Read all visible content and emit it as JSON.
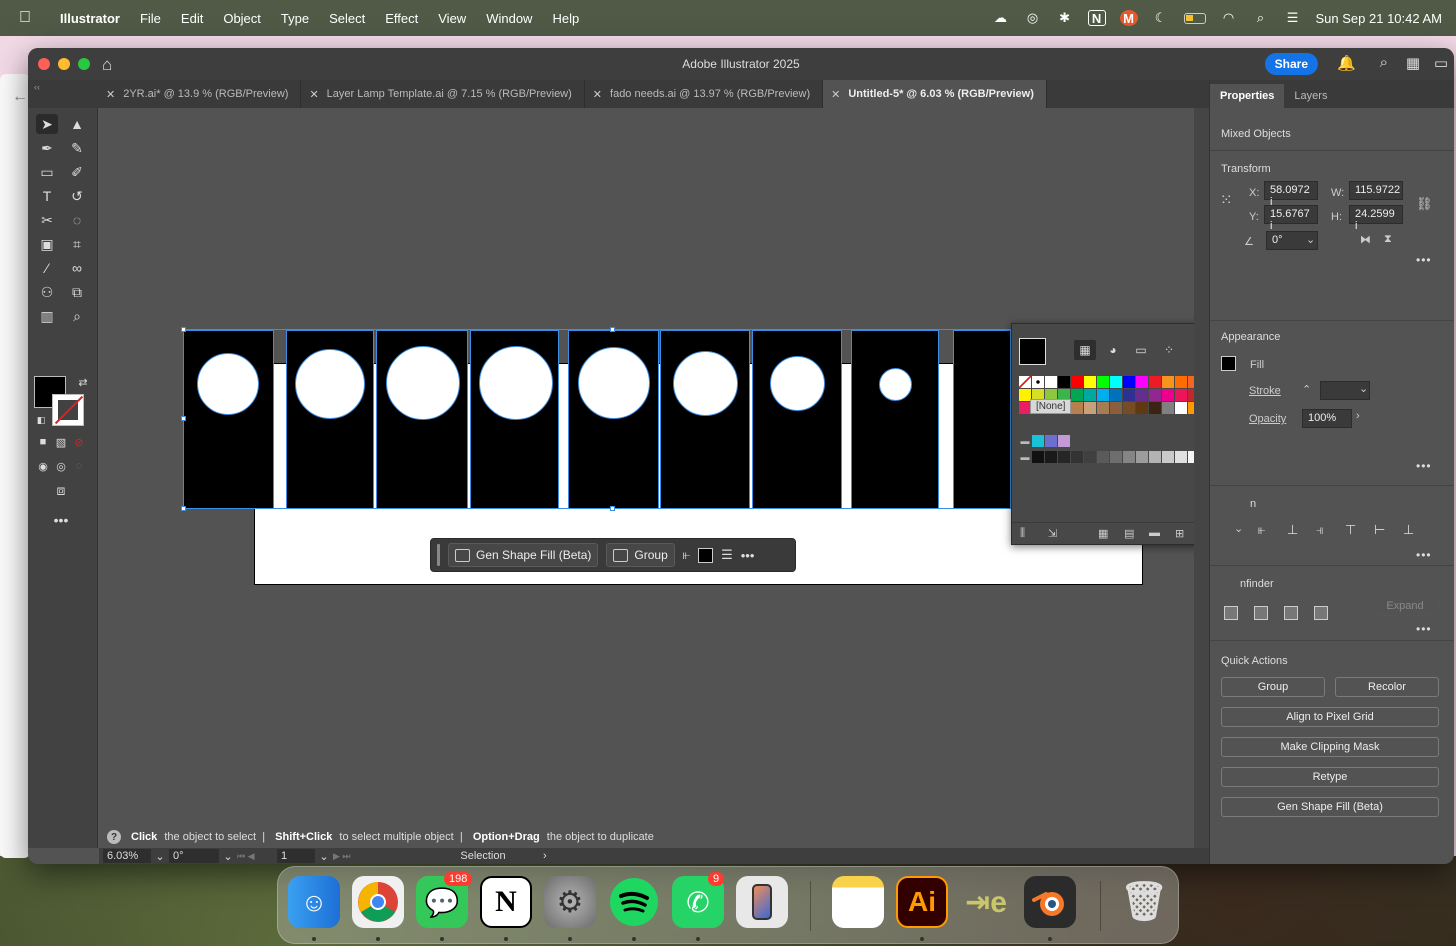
{
  "menubar": {
    "app_name": "Illustrator",
    "items": [
      "File",
      "Edit",
      "Object",
      "Type",
      "Select",
      "Effect",
      "View",
      "Window",
      "Help"
    ],
    "clock": "Sun Sep 21  10:42 AM"
  },
  "window": {
    "title": "Adobe Illustrator 2025",
    "share_label": "Share"
  },
  "tabs": [
    {
      "label": "2YR.ai* @ 13.9 % (RGB/Preview)",
      "active": false
    },
    {
      "label": "Layer Lamp Template.ai @ 7.15 % (RGB/Preview)",
      "active": false
    },
    {
      "label": "fado needs.ai @ 13.97 % (RGB/Preview)",
      "active": false
    },
    {
      "label": "Untitled-5* @ 6.03 % (RGB/Preview)",
      "active": true
    }
  ],
  "taskbar": {
    "gen_shape_fill": "Gen Shape Fill (Beta)",
    "group": "Group"
  },
  "swatches_popup": {
    "tooltip": "[None]"
  },
  "hint": {
    "p1_bold": "Click",
    "p1": " the object to select  |  ",
    "p2_bold": "Shift+Click",
    "p2": " to select multiple object  |  ",
    "p3_bold": "Option+Drag",
    "p3": " the object to duplicate"
  },
  "status": {
    "zoom": "6.03%",
    "rotation": "0°",
    "artboard": "1",
    "tool": "Selection"
  },
  "properties": {
    "tab_properties": "Properties",
    "tab_layers": "Layers",
    "selection_type": "Mixed Objects",
    "transform_title": "Transform",
    "x_label": "X:",
    "x_value": "58.0972 i",
    "y_label": "Y:",
    "y_value": "15.6767 i",
    "w_label": "W:",
    "w_value": "115.9722",
    "h_label": "H:",
    "h_value": "24.2599 i",
    "angle_value": "0°",
    "appearance_title": "Appearance",
    "fill_label": "Fill",
    "stroke_label": "Stroke",
    "opacity_label": "Opacity",
    "opacity_value": "100%",
    "align_title_partial": "n",
    "pathfinder_partial": "nfinder",
    "expand_label": "Expand",
    "quick_actions_title": "Quick Actions",
    "qa_group": "Group",
    "qa_recolor": "Recolor",
    "qa_align_pixel": "Align to Pixel Grid",
    "qa_clipping": "Make Clipping Mask",
    "qa_retype": "Retype",
    "qa_gen_fill": "Gen Shape Fill (Beta)"
  },
  "dock": {
    "messages_badge": "198",
    "whatsapp_badge": "9",
    "illustrator_label": "Ai"
  },
  "colors": {
    "accent": "#1473e6",
    "selection": "#3a8ee6",
    "ui_bg": "#535353"
  }
}
